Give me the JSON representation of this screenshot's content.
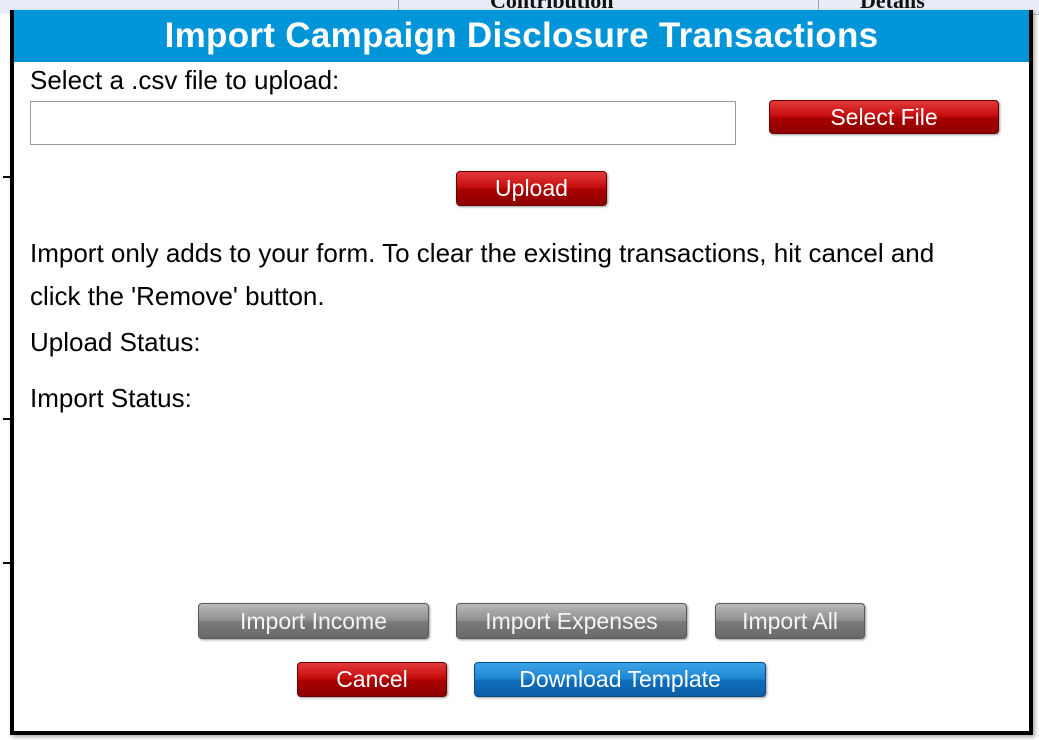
{
  "background": {
    "header_fragments": [
      "Contribution",
      "Details"
    ]
  },
  "dialog": {
    "title": "Import Campaign Disclosure Transactions",
    "file_prompt": "Select a .csv file to upload:",
    "file_input": {
      "value": "",
      "placeholder": ""
    },
    "select_file_label": "Select File",
    "upload_label": "Upload",
    "info_text": "Import only adds to your form. To clear the existing transactions, hit cancel and click the 'Remove' button.",
    "upload_status_label": "Upload Status:",
    "import_status_label": "Import Status:",
    "import_income_label": "Import Income",
    "import_expenses_label": "Import Expenses",
    "import_all_label": "Import All",
    "cancel_label": "Cancel",
    "download_template_label": "Download Template"
  },
  "colors": {
    "title_bar": "#0094d9",
    "button_red": "#c40b0b",
    "button_gray": "#8f8f8f",
    "button_blue": "#1f86d2"
  }
}
